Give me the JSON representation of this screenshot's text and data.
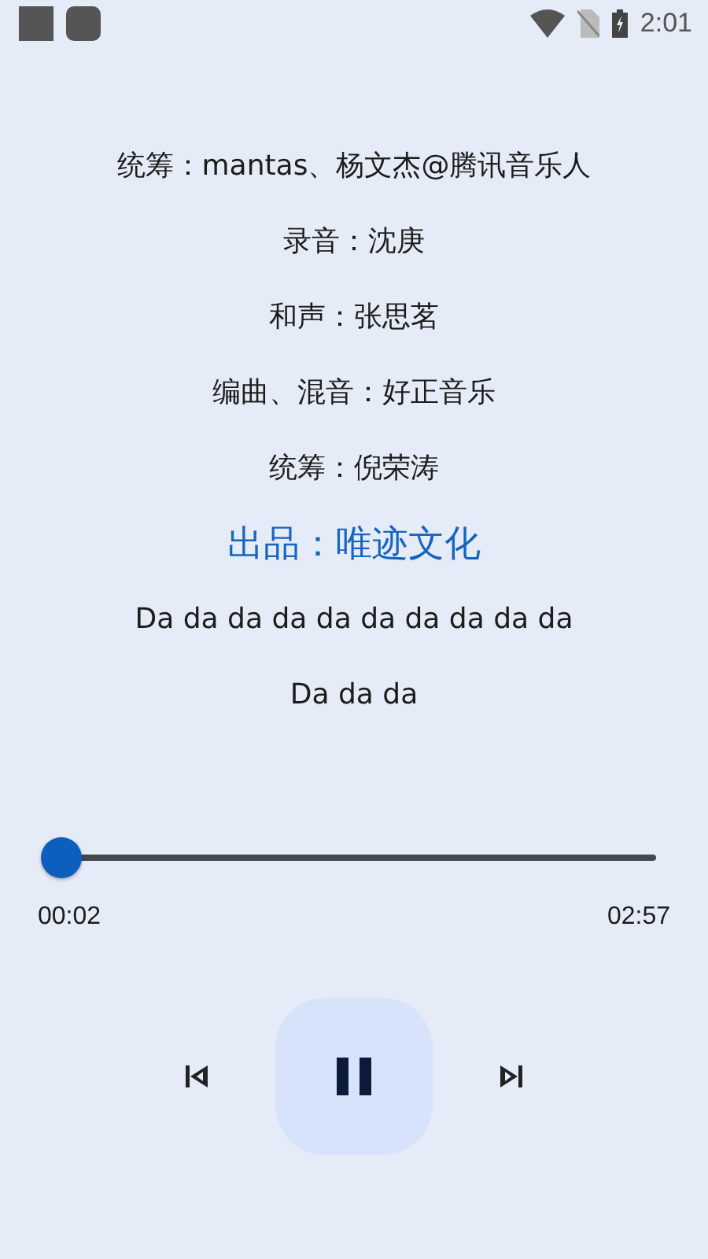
{
  "status_bar": {
    "time": "2:01"
  },
  "lyrics": [
    {
      "text": "统筹：mantas、杨文杰@腾讯音乐人",
      "selected": false
    },
    {
      "text": "录音：沈庚",
      "selected": false
    },
    {
      "text": "和声：张思茗",
      "selected": false
    },
    {
      "text": "编曲、混音：好正音乐",
      "selected": false
    },
    {
      "text": "统筹：倪荣涛",
      "selected": false
    },
    {
      "text": "出品：唯迹文化",
      "selected": true
    },
    {
      "text": "Da da da da da da da da da da",
      "selected": false
    },
    {
      "text": "Da da da",
      "selected": false
    }
  ],
  "progress": {
    "level": 0.01,
    "elapsed": "00:02",
    "total": "02:57"
  },
  "controls": {
    "playing": true
  }
}
